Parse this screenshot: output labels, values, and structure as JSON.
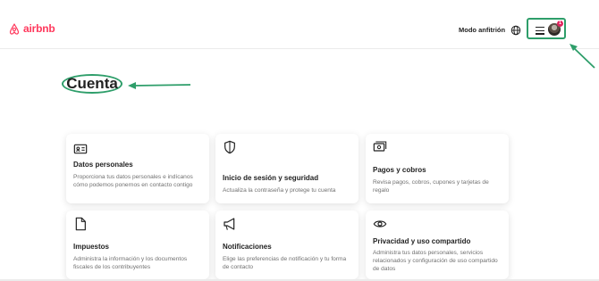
{
  "header": {
    "logo_text": "airbnb",
    "host_link": "Modo anfitrión",
    "notification_count": "1",
    "brand_color": "#ff385c",
    "highlight_color": "#2e9e6a"
  },
  "page": {
    "title": "Cuenta"
  },
  "cards": [
    {
      "icon": "id-card-icon",
      "title": "Datos personales",
      "description": "Proporciona tus datos personales e indícanos cómo podemos ponernos en contacto contigo"
    },
    {
      "icon": "shield-icon",
      "title": "Inicio de sesión y seguridad",
      "description": "Actualiza la contraseña y protege tu cuenta"
    },
    {
      "icon": "payments-icon",
      "title": "Pagos y cobros",
      "description": "Revisa pagos, cobros, cupones y tarjetas de regalo"
    },
    {
      "icon": "document-icon",
      "title": "Impuestos",
      "description": "Administra la información y los documentos fiscales de los contribuyentes"
    },
    {
      "icon": "megaphone-icon",
      "title": "Notificaciones",
      "description": "Elige las preferencias de notificación y tu forma de contacto"
    },
    {
      "icon": "eye-icon",
      "title": "Privacidad y uso compartido",
      "description": "Administra tus datos personales, servicios relacionados y configuración de uso compartido de datos"
    }
  ]
}
